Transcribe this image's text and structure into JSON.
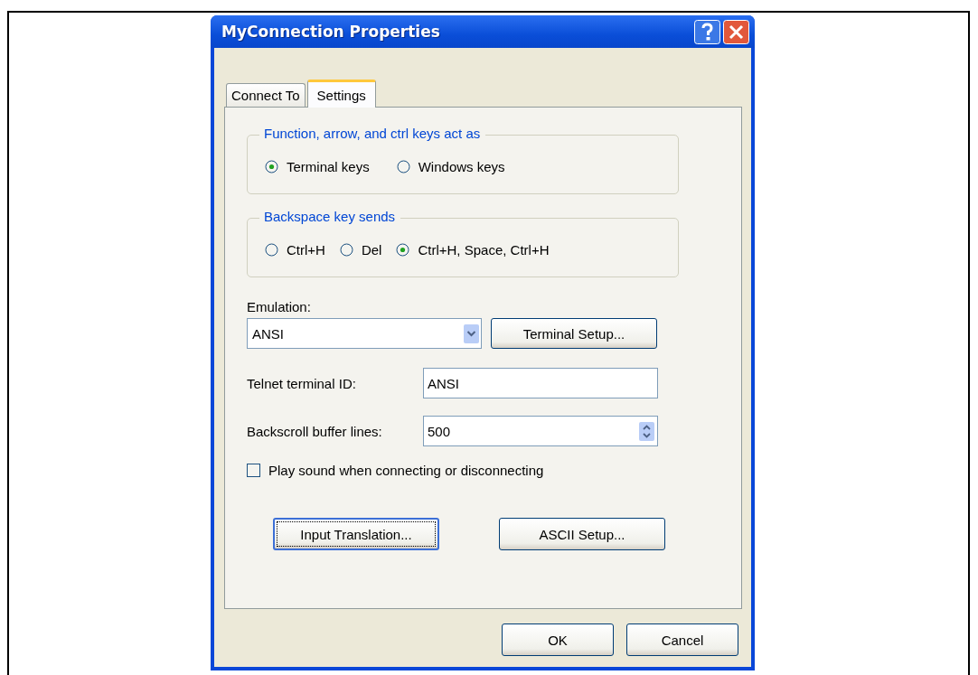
{
  "window": {
    "title": "MyConnection Properties"
  },
  "tabs": [
    {
      "label": "Connect To",
      "selected": false
    },
    {
      "label": "Settings",
      "selected": true
    }
  ],
  "key_group": {
    "title": "Function, arrow, and ctrl keys act as",
    "options": [
      {
        "label": "Terminal keys",
        "selected": true
      },
      {
        "label": "Windows keys",
        "selected": false
      }
    ]
  },
  "backspace_group": {
    "title": "Backspace key sends",
    "options": [
      {
        "label": "Ctrl+H",
        "selected": false
      },
      {
        "label": "Del",
        "selected": false
      },
      {
        "label": "Ctrl+H, Space, Ctrl+H",
        "selected": true
      }
    ]
  },
  "emulation": {
    "label": "Emulation:",
    "value": "ANSI",
    "button": "Terminal Setup..."
  },
  "telnet_id": {
    "label": "Telnet terminal ID:",
    "value": "ANSI"
  },
  "backscroll": {
    "label": "Backscroll buffer lines:",
    "value": "500"
  },
  "sound": {
    "label": "Play sound when connecting or disconnecting",
    "checked": false
  },
  "panel_buttons": [
    {
      "label": "Input Translation...",
      "focused": true
    },
    {
      "label": "ASCII Setup...",
      "focused": false
    }
  ],
  "buttons": [
    "OK",
    "Cancel"
  ]
}
